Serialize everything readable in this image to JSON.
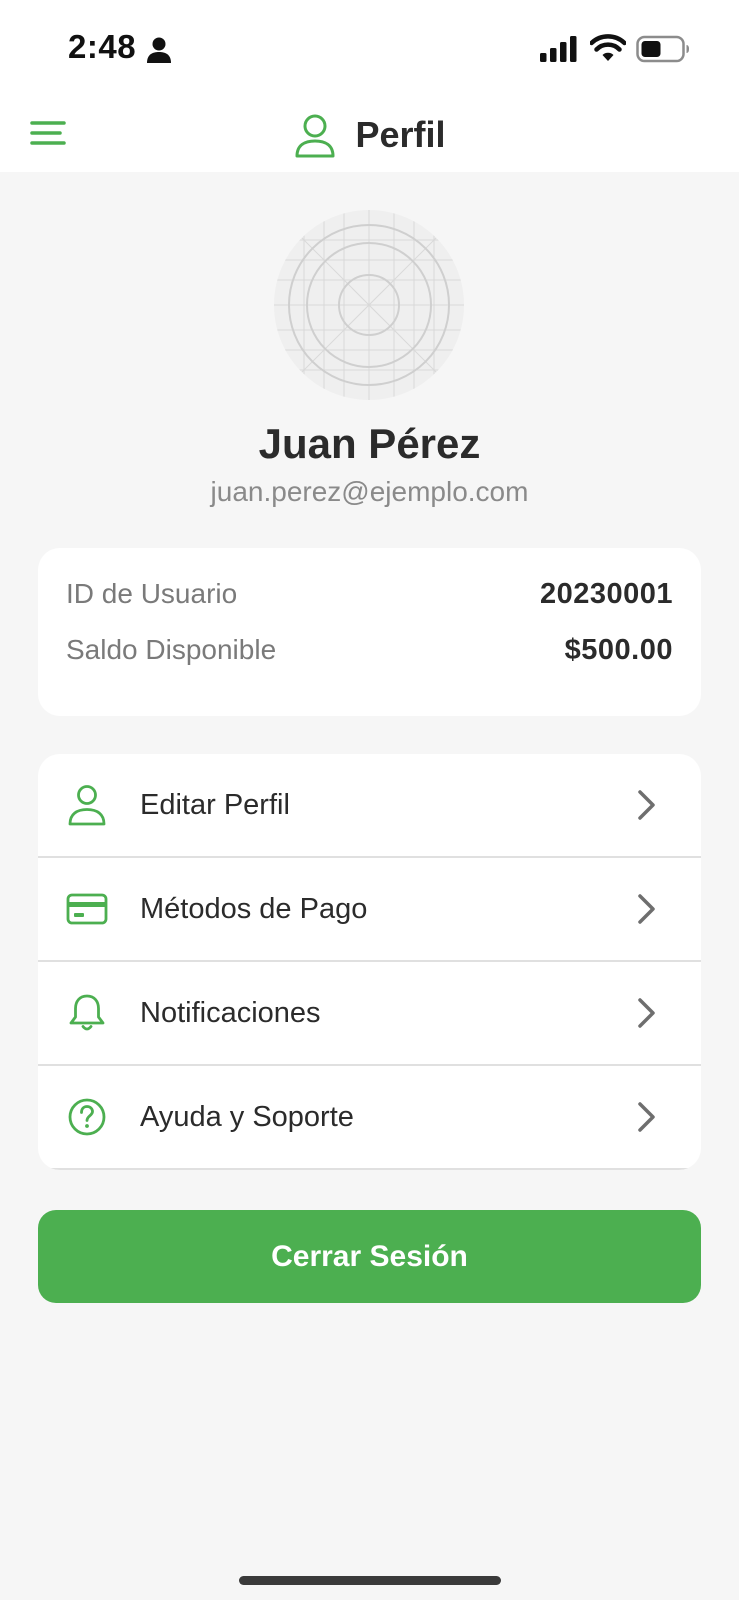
{
  "status_bar": {
    "time": "2:48",
    "icons": [
      "person-icon",
      "cellular-signal-icon",
      "wifi-icon",
      "battery-icon"
    ]
  },
  "header": {
    "menu_icon": "hamburger-menu-icon",
    "title_icon": "user-icon",
    "title": "Perfil"
  },
  "profile": {
    "avatar_icon": "avatar-placeholder",
    "name": "Juan Pérez",
    "email": "juan.perez@ejemplo.com"
  },
  "info": [
    {
      "label": "ID de Usuario",
      "value": "20230001"
    },
    {
      "label": "Saldo Disponible",
      "value": "$500.00"
    }
  ],
  "menu": [
    {
      "label": "Editar Perfil",
      "icon": "user-icon"
    },
    {
      "label": "Métodos de Pago",
      "icon": "credit-card-icon"
    },
    {
      "label": "Notificaciones",
      "icon": "bell-icon"
    },
    {
      "label": "Ayuda y Soporte",
      "icon": "help-circle-icon"
    }
  ],
  "logout_label": "Cerrar Sesión",
  "colors": {
    "accent": "#4caf50",
    "background": "#f6f6f6",
    "card": "#ffffff",
    "text_primary": "#2b2b2b",
    "text_secondary": "#7a7a7a"
  }
}
